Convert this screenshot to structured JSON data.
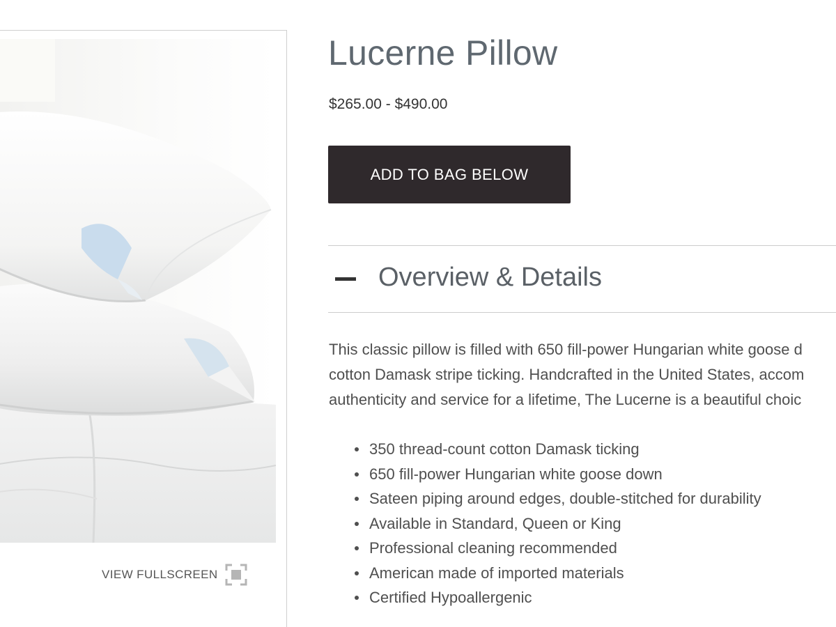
{
  "product": {
    "title": "Lucerne Pillow",
    "price": "$265.00 - $490.00",
    "add_to_bag_label": "ADD TO BAG BELOW"
  },
  "gallery": {
    "fullscreen_label": "VIEW FULLSCREEN",
    "fullscreen_icon": "fullscreen-icon"
  },
  "overview": {
    "toggle_icon": "minus-icon",
    "title": "Overview & Details",
    "description_lines": [
      "This classic pillow is filled with 650 fill-power Hungarian white goose d",
      "cotton Damask stripe ticking. Handcrafted in the United States, accom",
      "authenticity and service for a lifetime, The Lucerne is a beautiful choic"
    ],
    "features": [
      "350 thread-count cotton Damask ticking",
      "650 fill-power Hungarian white goose down",
      "Sateen piping around edges, double-stitched for durability",
      "Available in Standard, Queen or King",
      "Professional cleaning recommended",
      "American made of imported materials",
      "Certified Hypoallergenic"
    ]
  },
  "colors": {
    "button_bg": "#2f292c",
    "title_color": "#5f6870",
    "text_color": "#4f4f4f",
    "divider": "#cccccc"
  }
}
